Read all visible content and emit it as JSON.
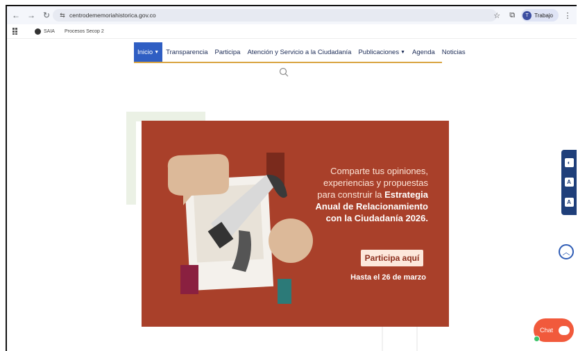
{
  "browser": {
    "url": "centrodememoriahistorica.gov.co",
    "profile_label": "Trabajo",
    "profile_initial": "T"
  },
  "bookmarks": [
    {
      "label": "SAIA"
    },
    {
      "label": "Procesos Secop 2"
    }
  ],
  "site_nav": {
    "items": [
      {
        "label": "Inicio",
        "has_caret": true
      },
      {
        "label": "Transparencia"
      },
      {
        "label": "Participa"
      },
      {
        "label": "Atención y Servicio a la Ciudadanía"
      },
      {
        "label": "Publicaciones",
        "has_caret": true
      },
      {
        "label": "Agenda"
      },
      {
        "label": "Noticias"
      }
    ]
  },
  "banner": {
    "line1": "Comparte tus opiniones,",
    "line2": "experiencias y propuestas",
    "line3_prefix": "para construir la",
    "line3_bold": "Estrategia",
    "line4": "Anual de Relacionamiento",
    "line5": "con la Ciudadanía 2026.",
    "cta": "Participa aquí",
    "deadline": "Hasta el 26 de marzo"
  },
  "chat": {
    "label": "Chat"
  },
  "colors": {
    "nav_active": "#2f5ec3",
    "nav_border": "#d9a441",
    "banner_bg": "#a9402a",
    "a11y_bg": "#1f3f7a",
    "chat_bg": "#f15a3c"
  }
}
